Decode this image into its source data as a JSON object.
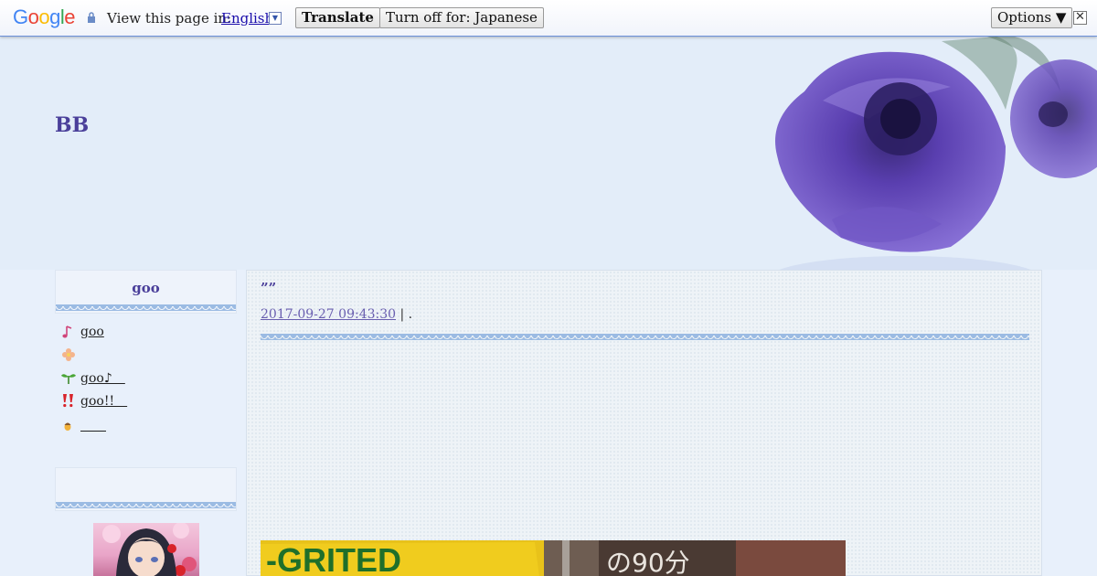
{
  "translate_bar": {
    "logo": "Google",
    "prompt": "View this page in:",
    "language": "English",
    "translate_label": "Translate",
    "turn_off_label": "Turn off for: Japanese",
    "options_label": "Options ▼",
    "close_label": "✕"
  },
  "header": {
    "site_title": "BB"
  },
  "sidebar": {
    "box1_title": "goo",
    "items": [
      {
        "icon": "music-note-icon",
        "label": "goo"
      },
      {
        "icon": "flower-icon",
        "label": ""
      },
      {
        "icon": "sprout-icon",
        "label": "goo♪＿"
      },
      {
        "icon": "double-exclamation-icon",
        "label": "goo!!＿"
      },
      {
        "icon": "acorn-icon",
        "label": "＿＿"
      }
    ],
    "box2_title": ""
  },
  "post": {
    "title": "””",
    "date": "2017-09-27 09:43:30",
    "separator": "|",
    "category": "."
  },
  "colors": {
    "title": "#4a3f9a",
    "lace": "#9bbbe3",
    "bar_border": "#6b90da"
  }
}
